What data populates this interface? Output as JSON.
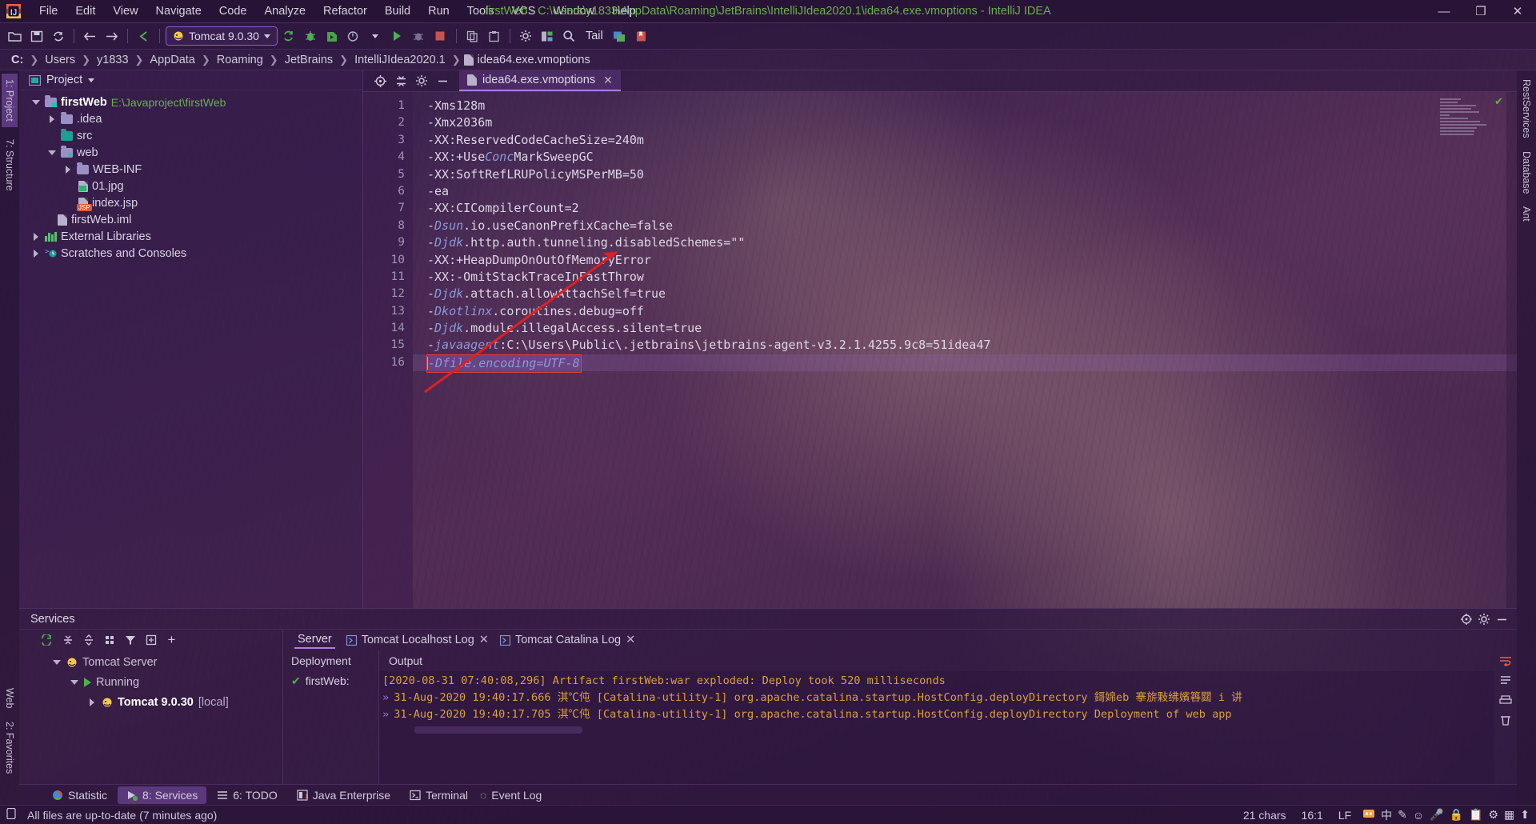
{
  "window": {
    "title": "firstWeb - C:\\Users\\y1833\\AppData\\Roaming\\JetBrains\\IntelliJIdea2020.1\\idea64.exe.vmoptions - IntelliJ IDEA",
    "minimize": "—",
    "maximize": "❐",
    "close": "✕"
  },
  "menu": [
    "File",
    "Edit",
    "View",
    "Navigate",
    "Code",
    "Analyze",
    "Refactor",
    "Build",
    "Run",
    "Tools",
    "VCS",
    "Window",
    "Help"
  ],
  "toolbar": {
    "run_config": "Tomcat 9.0.30",
    "tail_label": "Tail"
  },
  "breadcrumb": [
    "C:",
    "Users",
    "y1833",
    "AppData",
    "Roaming",
    "JetBrains",
    "IntelliJIdea2020.1",
    "idea64.exe.vmoptions"
  ],
  "left_rail": [
    "1: Project",
    "7: Structure",
    "Web"
  ],
  "right_rail": [
    "RestServices",
    "Database",
    "Ant"
  ],
  "favorites_rail": "2: Favorites",
  "project": {
    "title": "Project",
    "tree": [
      {
        "label": "firstWeb",
        "path": "E:\\Javaproject\\firstWeb",
        "indent": 0,
        "toggle": "down",
        "icon": "module-folder",
        "bold": true
      },
      {
        "label": ".idea",
        "path": "",
        "indent": 1,
        "toggle": "right",
        "icon": "folder",
        "bold": false
      },
      {
        "label": "src",
        "path": "",
        "indent": 1,
        "toggle": "none",
        "icon": "source-folder",
        "bold": false
      },
      {
        "label": "web",
        "path": "",
        "indent": 1,
        "toggle": "down",
        "icon": "web-folder",
        "bold": false
      },
      {
        "label": "WEB-INF",
        "path": "",
        "indent": 2,
        "toggle": "right",
        "icon": "folder",
        "bold": false
      },
      {
        "label": "01.jpg",
        "path": "",
        "indent": 2,
        "toggle": "none",
        "icon": "image-file",
        "bold": false
      },
      {
        "label": "index.jsp",
        "path": "",
        "indent": 2,
        "toggle": "none",
        "icon": "jsp-file",
        "bold": false
      },
      {
        "label": "firstWeb.iml",
        "path": "",
        "indent": 1,
        "toggle": "none",
        "icon": "iml-file",
        "bold": false
      },
      {
        "label": "External Libraries",
        "path": "",
        "indent": 0,
        "toggle": "right",
        "icon": "library",
        "bold": false
      },
      {
        "label": "Scratches and Consoles",
        "path": "",
        "indent": 0,
        "toggle": "right",
        "icon": "scratches",
        "bold": false
      }
    ]
  },
  "editor": {
    "tab_label": "idea64.exe.vmoptions",
    "tab_close": "✕",
    "lines": [
      {
        "n": "1",
        "text": "-Xms128m",
        "kw": "",
        "pre": "",
        "post": ""
      },
      {
        "n": "2",
        "text": "-Xmx2036m",
        "kw": "",
        "pre": "",
        "post": ""
      },
      {
        "n": "3",
        "text": "-XX:ReservedCodeCacheSize=240m",
        "kw": "",
        "pre": "",
        "post": ""
      },
      {
        "n": "4",
        "text": "",
        "pre": "-XX:+Use",
        "kw": "Conc",
        "post": "MarkSweepGC"
      },
      {
        "n": "5",
        "text": "-XX:SoftRefLRUPolicyMSPerMB=50",
        "kw": "",
        "pre": "",
        "post": ""
      },
      {
        "n": "6",
        "text": "-ea",
        "kw": "",
        "pre": "",
        "post": ""
      },
      {
        "n": "7",
        "text": "-XX:CICompilerCount=2",
        "kw": "",
        "pre": "",
        "post": ""
      },
      {
        "n": "8",
        "text": "",
        "pre": "-",
        "kw": "Dsun",
        "post": ".io.useCanonPrefixCache=false"
      },
      {
        "n": "9",
        "text": "",
        "pre": "-",
        "kw": "Djdk",
        "post": ".http.auth.tunneling.disabledSchemes=\"\""
      },
      {
        "n": "10",
        "text": "-XX:+HeapDumpOnOutOfMemoryError",
        "kw": "",
        "pre": "",
        "post": ""
      },
      {
        "n": "11",
        "text": "-XX:-OmitStackTraceInFastThrow",
        "kw": "",
        "pre": "",
        "post": ""
      },
      {
        "n": "12",
        "text": "",
        "pre": "-",
        "kw": "Djdk",
        "post": ".attach.allowAttachSelf=true"
      },
      {
        "n": "13",
        "text": "",
        "pre": "-",
        "kw": "Dkotlinx",
        "post": ".coroutines.debug=off"
      },
      {
        "n": "14",
        "text": "",
        "pre": "-",
        "kw": "Djdk",
        "post": ".module.illegalAccess.silent=true"
      },
      {
        "n": "15",
        "text": "",
        "pre": "-",
        "kw": "javaagent",
        "post": ":C:\\Users\\Public\\.jetbrains\\jetbrains-agent-v3.2.1.4255.9c8=51idea47"
      },
      {
        "n": "16",
        "text": "-Dfile.encoding=UTF-8",
        "kw": "",
        "pre": "",
        "post": "",
        "selected": true
      }
    ],
    "selected_line_text": "-Dfile.encoding=UTF-8"
  },
  "services": {
    "title": "Services",
    "tree": [
      {
        "label": "Tomcat Server",
        "indent": 0,
        "toggle": "down",
        "icon": "tomcat-icon"
      },
      {
        "label": "Running",
        "indent": 1,
        "toggle": "down",
        "icon": "run-icon"
      },
      {
        "label": "Tomcat 9.0.30",
        "suffix": "[local]",
        "indent": 2,
        "toggle": "right",
        "icon": "tomcat-icon",
        "bold": true
      }
    ],
    "deployment_header": "Deployment",
    "deployment_item": "firstWeb:",
    "output_header": "Output",
    "tabs": [
      {
        "label": "Server",
        "active": true,
        "closable": false
      },
      {
        "label": "Tomcat Localhost Log",
        "active": false,
        "closable": true
      },
      {
        "label": "Tomcat Catalina Log",
        "active": false,
        "closable": true
      }
    ],
    "console": [
      "[2020-08-31 07:40:08,296] Artifact firstWeb:war exploded: Deploy took 520 milliseconds",
      "31-Aug-2020 19:40:17.666 淇℃伅 [Catalina-utility-1] org.apache.catalina.startup.HostConfig.deployDirectory 鎶婂eb 搴旂敤绋嬪簭閮 i 讲",
      "31-Aug-2020 19:40:17.705 淇℃伅 [Catalina-utility-1] org.apache.catalina.startup.HostConfig.deployDirectory Deployment of web app"
    ]
  },
  "bottom_tabs": [
    {
      "label": "Statistic",
      "icon": "statistic-icon",
      "active": false,
      "mnemonic": ""
    },
    {
      "label": "8: Services",
      "icon": "services-icon",
      "active": true,
      "mnemonic": "8"
    },
    {
      "label": "6: TODO",
      "icon": "todo-icon",
      "active": false,
      "mnemonic": "6"
    },
    {
      "label": "Java Enterprise",
      "icon": "java-enterprise-icon",
      "active": false,
      "mnemonic": ""
    },
    {
      "label": "Terminal",
      "icon": "terminal-icon",
      "active": false,
      "mnemonic": ""
    }
  ],
  "status": {
    "message": "All files are up-to-date (7 minutes ago)",
    "chars": "21 chars",
    "caret": "16:1",
    "line_sep": "LF",
    "event_log": "Event Log",
    "tray": [
      "中",
      "✎",
      "☺",
      "🎤",
      "🔒",
      "📋",
      "⚙",
      "▦",
      "⬆"
    ]
  },
  "colors": {
    "accent_green": "#6ab04c",
    "selection_border": "#e04040",
    "arrow_red": "#e02020",
    "keyword_blue": "#8a9ad8",
    "console_orange": "#d8a03c"
  }
}
